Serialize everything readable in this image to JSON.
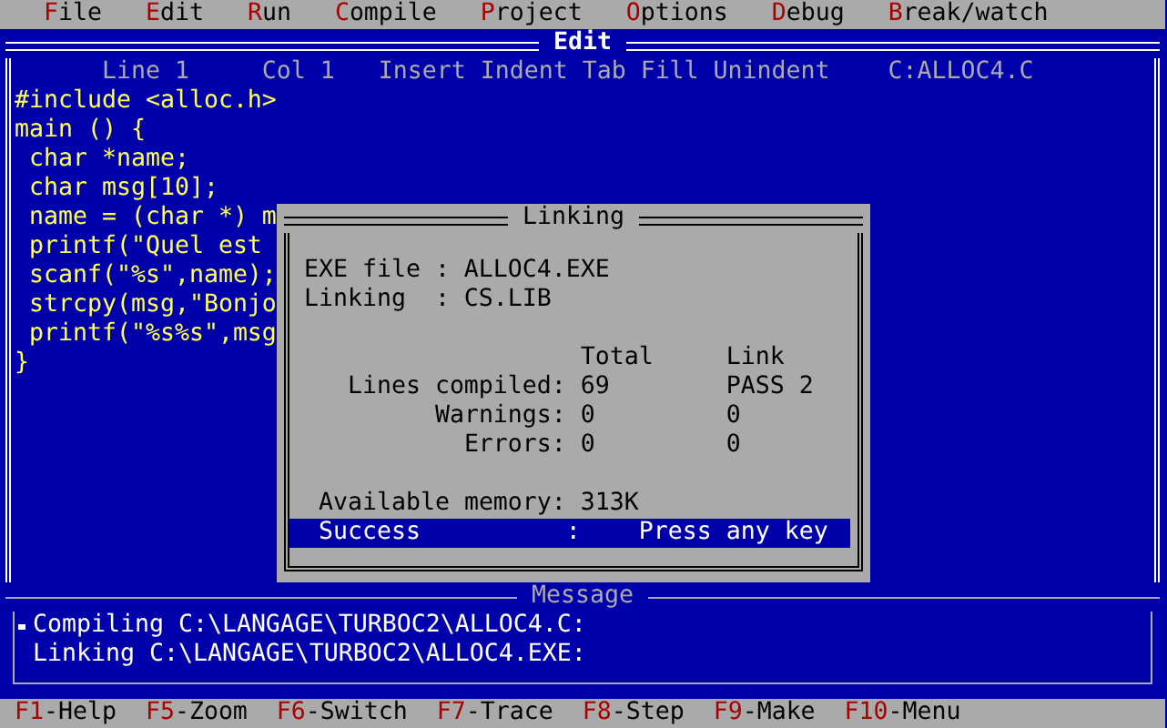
{
  "menu": [
    {
      "label": "File"
    },
    {
      "label": "Edit"
    },
    {
      "label": "Run"
    },
    {
      "label": "Compile"
    },
    {
      "label": "Project"
    },
    {
      "label": "Options"
    },
    {
      "label": "Debug"
    },
    {
      "label": "Break/watch"
    }
  ],
  "editor": {
    "title": "Edit",
    "status": {
      "line": "Line 1",
      "col": "Col 1",
      "modes": "Insert Indent Tab Fill Unindent",
      "file": "C:ALLOC4.C"
    },
    "lines": [
      "#include <alloc.h>",
      "main () {",
      " char *name;",
      " char msg[10];",
      " name = (char *) m",
      " printf(\"Quel est",
      " scanf(\"%s\",name);",
      " strcpy(msg,\"Bonjo",
      " printf(\"%s%s\",msg",
      "}"
    ]
  },
  "dialog": {
    "title": "Linking",
    "info": [
      {
        "label": "EXE file",
        "separator": ":",
        "value": "ALLOC4.EXE"
      },
      {
        "label": "Linking",
        "separator": ":",
        "value": "CS.LIB"
      }
    ],
    "columns": [
      "Total",
      "Link"
    ],
    "stats": [
      {
        "label": "Lines compiled:",
        "total": "69",
        "link": "PASS 2"
      },
      {
        "label": "Warnings:",
        "total": "0",
        "link": "0"
      },
      {
        "label": "Errors:",
        "total": "0",
        "link": "0"
      }
    ],
    "memory": {
      "label": "Available memory:",
      "value": "313K"
    },
    "result": {
      "status": "Success",
      "separator": ":",
      "prompt": "Press any key"
    }
  },
  "messages": {
    "title": "Message",
    "lines": [
      {
        "text": "Compiling C:\\LANGAGE\\TURBOC2\\ALLOC4.C:",
        "selected": true
      },
      {
        "text": "Linking C:\\LANGAGE\\TURBOC2\\ALLOC4.EXE:",
        "selected": false
      }
    ]
  },
  "keys": [
    {
      "key": "F1",
      "label": "-Help"
    },
    {
      "key": "F5",
      "label": "-Zoom"
    },
    {
      "key": "F6",
      "label": "-Switch"
    },
    {
      "key": "F7",
      "label": "-Trace"
    },
    {
      "key": "F8",
      "label": "-Step"
    },
    {
      "key": "F9",
      "label": "-Make"
    },
    {
      "key": "F10",
      "label": "-Menu"
    }
  ]
}
